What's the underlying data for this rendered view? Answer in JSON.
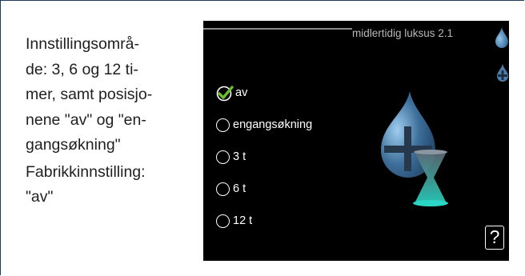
{
  "description": {
    "range_lines": [
      "Innstillingsområ-",
      "de: 3, 6 og 12 ti-",
      "mer, samt posisjo-",
      "nene \"av\" og \"en-",
      "gangsøkning\""
    ],
    "factory_lines": [
      "Fabrikkinnstilling:",
      "\"av\""
    ]
  },
  "screen": {
    "title": "midlertidig luksus 2.1",
    "options": [
      {
        "label": "av",
        "selected": true
      },
      {
        "label": "engangsøkning",
        "selected": false
      },
      {
        "label": "3 t",
        "selected": false
      },
      {
        "label": "6 t",
        "selected": false
      },
      {
        "label": "12 t",
        "selected": false
      }
    ],
    "help_label": "?",
    "icons": {
      "menu": "water-drop-icon",
      "submenu": "drop-plus-icon",
      "illustration": "drop-hourglass-icon",
      "check": "check-icon"
    },
    "colors": {
      "background": "#000000",
      "text": "#ffffff",
      "drop": "#3d6f9a",
      "check": "#6cbf2a",
      "hourglass_glow": "#2bd6c4"
    }
  }
}
